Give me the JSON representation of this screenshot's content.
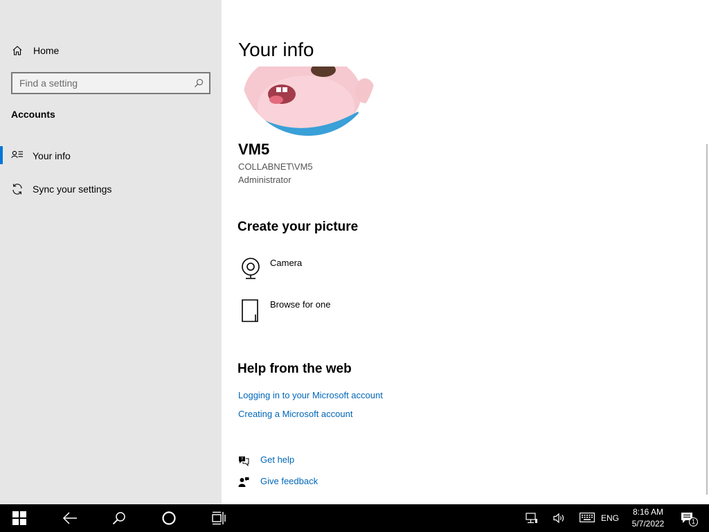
{
  "sidebar": {
    "home_label": "Home",
    "search_placeholder": "Find a setting",
    "section_title": "Accounts",
    "items": [
      {
        "label": "Your info",
        "icon": "contact-info-icon",
        "selected": true
      },
      {
        "label": "Sync your settings",
        "icon": "sync-icon",
        "selected": false
      }
    ]
  },
  "main": {
    "title": "Your info",
    "user": {
      "name": "VM5",
      "domain_account": "COLLABNET\\VM5",
      "role": "Administrator"
    },
    "create_picture": {
      "heading": "Create your picture",
      "options": [
        {
          "label": "Camera",
          "icon": "camera-icon"
        },
        {
          "label": "Browse for one",
          "icon": "browse-file-icon"
        }
      ]
    },
    "help_web": {
      "heading": "Help from the web",
      "links": [
        "Logging in to your Microsoft account",
        "Creating a Microsoft account"
      ]
    },
    "footer_links": [
      {
        "label": "Get help",
        "icon": "get-help-icon"
      },
      {
        "label": "Give feedback",
        "icon": "feedback-icon"
      }
    ]
  },
  "taskbar": {
    "language": "ENG",
    "time": "8:16 AM",
    "date": "5/7/2022",
    "notification_count": "1"
  },
  "colors": {
    "accent": "#0078d7",
    "link": "#0067b8",
    "sidebar_bg": "#e6e6e6",
    "taskbar_bg": "#000000"
  }
}
